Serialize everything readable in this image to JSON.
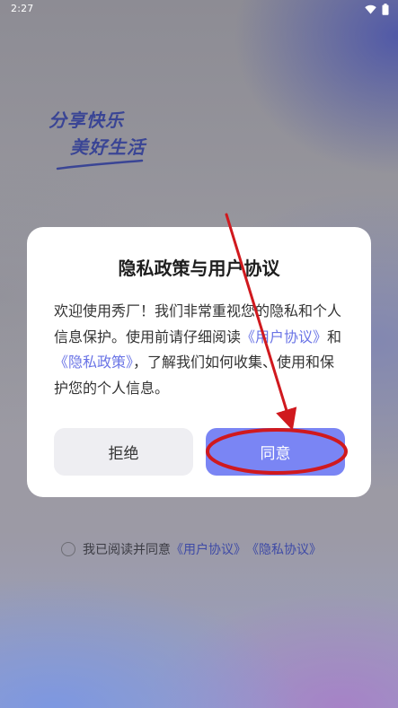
{
  "status_bar": {
    "time": "2:27",
    "icons": [
      "wifi-icon",
      "battery-icon"
    ]
  },
  "slogan": {
    "line1": "分享快乐",
    "line2": "美好生活"
  },
  "dialog": {
    "title": "隐私政策与用户协议",
    "body_prefix": "欢迎使用秀厂！我们非常重视您的隐私和个人信息保护。使用前请仔细阅读",
    "link_user_agreement": "《用户协议》",
    "body_and": "和",
    "link_privacy_policy": "《隐私政策》",
    "body_suffix": "，了解我们如何收集、使用和保护您的个人信息。",
    "decline_label": "拒绝",
    "agree_label": "同意"
  },
  "agreement": {
    "text": "我已阅读并同意",
    "link_user": "《用户协议》",
    "link_privacy": "《隐私协议》",
    "checked": false
  },
  "colors": {
    "accent": "#7a85f4",
    "link": "#6a74e6",
    "annotation": "#d0191e"
  }
}
